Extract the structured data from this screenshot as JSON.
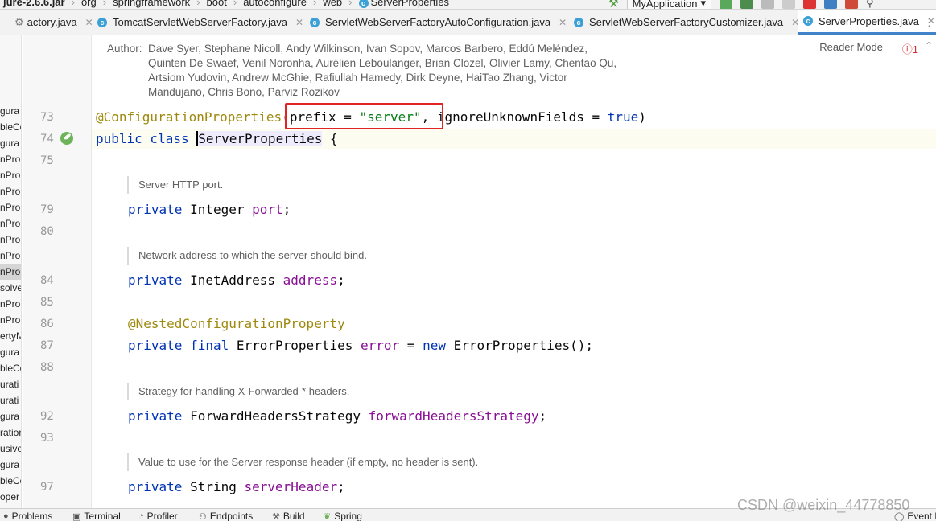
{
  "breadcrumbs": [
    "jure-2.6.6.jar",
    "org",
    "springframework",
    "boot",
    "autoconfigure",
    "web",
    "ServerProperties"
  ],
  "run_config": "MyApplication",
  "tabs": [
    {
      "label": "actory.java"
    },
    {
      "label": "TomcatServletWebServerFactory.java"
    },
    {
      "label": "ServletWebServerFactoryAutoConfiguration.java"
    },
    {
      "label": "ServletWebServerFactoryCustomizer.java"
    },
    {
      "label": "ServerProperties.java"
    }
  ],
  "left_panel": [
    "gura",
    "bleCo",
    "gura",
    "nProp",
    "nProp",
    "nProp",
    "nProp",
    "nProp",
    "nProp",
    "nProp",
    "nProp",
    "solve",
    "nProp",
    "nProp",
    "ertyM",
    "gura",
    "bleCo",
    "urati",
    "urati",
    "gura",
    "ration",
    "usive",
    "gura",
    "bleCo",
    "oper"
  ],
  "editor": {
    "reader_mode": "Reader Mode",
    "error_count": "1",
    "author_label": "Author:",
    "author_lines": [
      "Dave Syer, Stephane Nicoll, Andy Wilkinson, Ivan Sopov, Marcos Barbero, Eddú Meléndez,",
      "Quinten De Swaef, Venil Noronha, Aurélien Leboulanger, Brian Clozel, Olivier Lamy, Chentao Qu,",
      "Artsiom Yudovin, Andrew McGhie, Rafiullah Hamedy, Dirk Deyne, HaiTao Zhang, Victor",
      "Mandujano, Chris Bono, Parviz Rozikov"
    ],
    "line_numbers": [
      "73",
      "74",
      "75",
      "79",
      "80",
      "84",
      "85",
      "86",
      "87",
      "88",
      "92",
      "93",
      "97"
    ],
    "code": {
      "l73_ann": "@ConfigurationProperties",
      "l73_open": "(prefix = ",
      "l73_str": "\"server\"",
      "l73_rest": ", ignoreUnknownFields = ",
      "l73_true": "true",
      "l73_close": ")",
      "l74_kw": "public class ",
      "l74_name": "ServerProperties",
      "l74_rest": " {",
      "l79_kw": "private ",
      "l79_type": "Integer ",
      "l79_fld": "port",
      "l79_end": ";",
      "l84_kw": "private ",
      "l84_type": "InetAddress ",
      "l84_fld": "address",
      "l84_end": ";",
      "l86_ann": "@NestedConfigurationProperty",
      "l87_kw": "private final ",
      "l87_type": "ErrorProperties ",
      "l87_fld": "error",
      "l87_eq": " = ",
      "l87_new": "new ",
      "l87_call": "ErrorProperties();",
      "l92_kw": "private ",
      "l92_type": "ForwardHeadersStrategy ",
      "l92_fld": "forwardHeadersStrategy",
      "l92_end": ";",
      "l97_kw": "private ",
      "l97_type": "String ",
      "l97_fld": "serverHeader",
      "l97_end": ";"
    },
    "docs": [
      "Server HTTP port.",
      "Network address to which the server should bind.",
      "Strategy for handling X-Forwarded-* headers.",
      "Value to use for the Server response header (if empty, no header is sent)."
    ]
  },
  "bottom_tools": [
    "Problems",
    "Terminal",
    "Profiler",
    "Endpoints",
    "Build",
    "Spring",
    "Event L"
  ],
  "watermark": "CSDN @weixin_44778850",
  "colors": {
    "highlight_box": "#e02424",
    "active_tab": "#4083c9"
  }
}
